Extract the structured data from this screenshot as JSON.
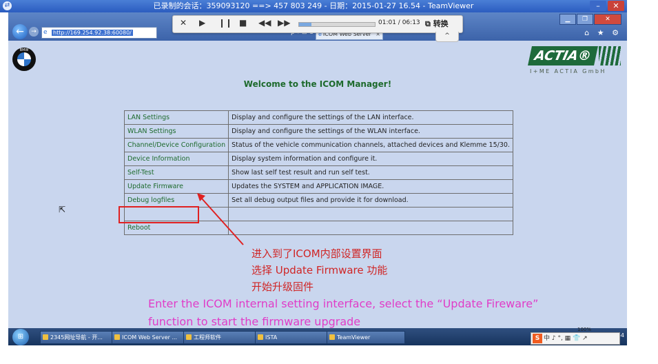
{
  "teamviewer": {
    "title": "已录制的会话：359093120 ==> 457 803 249 - 日期：2015-01-27 16.54 - TeamViewer",
    "minimize": "–",
    "close": "✕"
  },
  "browser": {
    "url": "http://169.254.92.38:60080/",
    "tab_title": "ICOM Web Server",
    "tab_close": "×",
    "addr_tools": "ρ ▾ ⊡ C",
    "fav_icons": "⌂ ★ ⚙"
  },
  "window_buttons": {
    "minimize": "▁",
    "restore": "❐",
    "close": "✕"
  },
  "playback": {
    "elapsed": "01:01",
    "total": "06:13",
    "progress": 0.164,
    "convert_label": "转换",
    "collapse": "^"
  },
  "page": {
    "bmw_label": "BMW",
    "actia_word": "ACTIA®",
    "actia_sub": "I+ME ACTIA GmbH",
    "welcome": "Welcome to the ICOM Manager!",
    "menu": [
      {
        "link": "LAN Settings",
        "desc": "Display and configure the settings of the LAN interface."
      },
      {
        "link": "WLAN Settings",
        "desc": "Display and configure the settings of the WLAN interface."
      },
      {
        "link": "Channel/Device Configuration",
        "desc": "Status of the vehicle communication channels, attached devices and Klemme 15/30."
      },
      {
        "link": "Device Information",
        "desc": "Display system information and configure it."
      },
      {
        "link": "Self-Test",
        "desc": "Show last self test result and run self test."
      },
      {
        "link": "Update Firmware",
        "desc": "Updates the SYSTEM and APPLICATION IMAGE."
      },
      {
        "link": "Debug logfiles",
        "desc": "Set all debug output files and provide it for download."
      },
      {
        "link": "",
        "desc": ""
      },
      {
        "link": "Reboot",
        "desc": ""
      }
    ]
  },
  "annotation": {
    "cn_line1": "进入到了ICOM内部设置界面",
    "cn_line2": "选择 Update Firmware 功能",
    "cn_line3": "开始升级固件",
    "en_line1": "Enter the ICOM internal setting interface, select the “Update Fireware”",
    "en_line2": "function to start the firmware upgrade"
  },
  "taskbar": {
    "items": [
      "2345网址导航 - 开...",
      "ICOM Web Server ...",
      "工程师软件",
      "ISTA",
      "TeamViewer"
    ],
    "clock": "16:54",
    "zoom": "100%",
    "ime": "中 ♪ °, ▦ 👕 ↗"
  },
  "colors": {
    "link_green": "#1d6a2c",
    "annotation_red": "#d02525",
    "annotation_magenta": "#e03cc8",
    "page_bg": "#c9d6ee",
    "actia_green": "#1e6a3b"
  }
}
